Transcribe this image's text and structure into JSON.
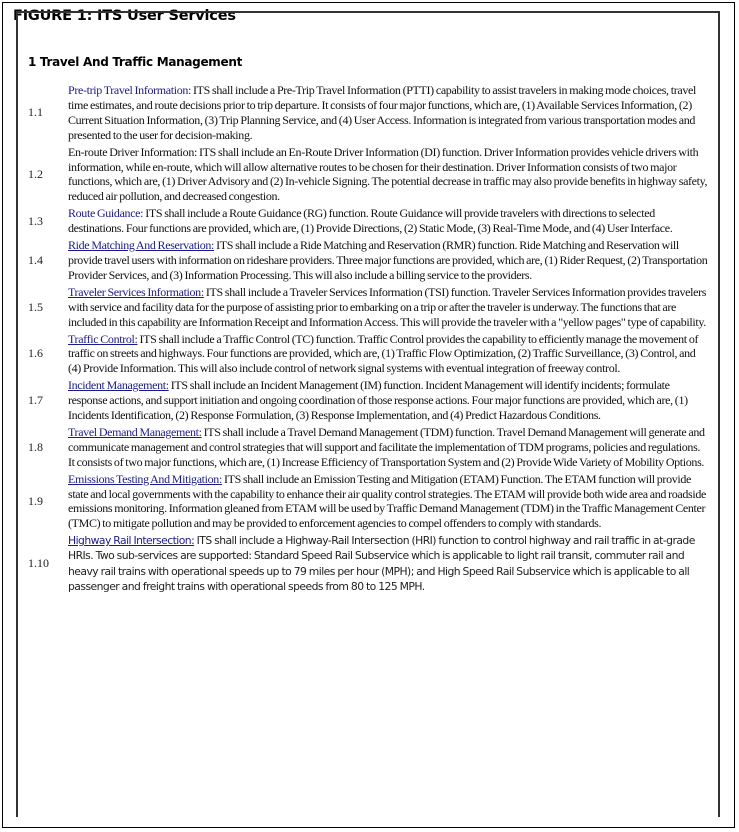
{
  "figure": {
    "title": "FIGURE 1:  ITS User Services",
    "section_title": "1 Travel And Traffic Management",
    "colors": {
      "link": "#1a1a8c",
      "text": "#111111",
      "border": "#000000"
    },
    "items": [
      {
        "number": "1.1",
        "lead": "Pre-trip Travel Information:",
        "underlined": false,
        "body": " ITS shall include a Pre-Trip Travel Information (PTTI) capability to assist travelers in making mode choices, travel time estimates, and route decisions prior to trip departure. It consists of four major functions, which are, (1) Available Services Information, (2) Current Situation Information, (3) Trip Planning Service, and (4) User Access. Information is integrated from various transportation modes and presented to the user for decision-making."
      },
      {
        "number": "1.2",
        "lead": "",
        "underlined": false,
        "body": "En-route Driver Information: ITS shall include an En-Route Driver Information (DI) function. Driver Information provides vehicle drivers with information, while en-route, which will allow alternative routes to be chosen for their destination. Driver Information consists of two major functions, which are, (1) Driver Advisory and (2) In-vehicle Signing. The potential decrease in traffic may also provide benefits in highway safety, reduced air pollution, and decreased congestion."
      },
      {
        "number": "1.3",
        "lead": "Route Guidance:",
        "underlined": false,
        "body": " ITS shall include a Route Guidance (RG) function. Route Guidance will provide travelers with directions to selected destinations. Four functions are provided, which are, (1) Provide Directions, (2) Static Mode, (3) Real-Time Mode, and (4) User Interface."
      },
      {
        "number": "1.4",
        "lead": "Ride Matching And Reservation:",
        "underlined": true,
        "body": " ITS shall include a Ride Matching and Reservation (RMR) function. Ride Matching and Reservation will provide travel users with information on rideshare providers. Three major functions are provided, which are, (1) Rider Request, (2) Transportation Provider Services, and (3) Information Processing. This will also include a billing service to the providers."
      },
      {
        "number": "1.5",
        "lead": "Traveler Services Information:",
        "underlined": true,
        "body": " ITS shall include a Traveler Services Information (TSI) function. Traveler Services Information provides travelers with service and facility data for the purpose of assisting prior to embarking on a trip or after the traveler is underway. The functions that are included in this capability are Information Receipt and Information Access. This will provide the traveler with a \"yellow pages\" type of capability."
      },
      {
        "number": "1.6",
        "lead": "Traffic Control:",
        "underlined": true,
        "body": " ITS shall include a Traffic Control (TC) function. Traffic Control provides the capability to efficiently manage the movement of traffic on streets and highways. Four functions are provided, which are, (1) Traffic Flow Optimization, (2) Traffic Surveillance, (3) Control, and (4) Provide Information. This will also include control of network signal systems with eventual integration of freeway control."
      },
      {
        "number": "1.7",
        "lead": "Incident Management:",
        "underlined": true,
        "body": " ITS shall include an Incident Management (IM) function. Incident Management will identify incidents; formulate response actions, and support initiation and ongoing coordination of those response actions. Four major functions are provided, which are, (1) Incidents Identification, (2) Response Formulation, (3) Response Implementation, and (4) Predict Hazardous Conditions."
      },
      {
        "number": "1.8",
        "lead": "Travel Demand Management:",
        "underlined": true,
        "body": " ITS shall include a Travel Demand Management (TDM) function. Travel Demand Management will generate and communicate management and control strategies that will support and facilitate the implementation of TDM programs, policies and regulations. It consists of two major functions, which are, (1) Increase Efficiency of Transportation System and (2) Provide Wide Variety of Mobility Options."
      },
      {
        "number": "1.9",
        "lead": "Emissions Testing And Mitigation:",
        "underlined": true,
        "body": " ITS shall include an Emission Testing and Mitigation (ETAM) Function. The ETAM function will provide state and local governments with the capability to enhance their air quality control strategies. The ETAM will provide both wide area and roadside emissions monitoring. Information gleaned from ETAM will be used by Traffic Demand Management (TDM) in the Traffic Management Center (TMC) to mitigate pollution and may be provided to enforcement agencies to compel offenders to comply with standards."
      },
      {
        "number": "1.10",
        "lead": "Highway Rail Intersection:",
        "underlined": true,
        "body": " ITS shall include a Highway-Rail Intersection (HRI) function to control highway and rail traffic in at-grade HRIs. Two sub-services are supported: Standard Speed Rail Subservice which is applicable to light rail transit, commuter rail and heavy rail trains with operational speeds up to 79 miles per hour (MPH); and High Speed Rail Subservice which is applicable to all passenger and freight trains with operational speeds from 80 to 125 MPH."
      }
    ]
  }
}
